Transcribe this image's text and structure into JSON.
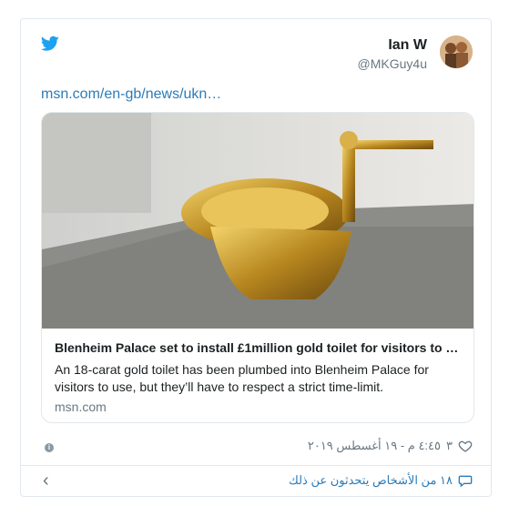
{
  "author": {
    "name": "Ian W",
    "handle": "@MKGuy4u"
  },
  "link_text": "msn.com/en-gb/news/ukn…",
  "card": {
    "title": "Blenheim Palace set to install £1million gold toilet for visitors to …",
    "description": "An 18-carat gold toilet has been plumbed into Blenheim Palace for visitors to use, but they’ll have to respect a strict time-limit.",
    "domain": "msn.com"
  },
  "meta": {
    "likes": "٣",
    "timestamp": "٤:٤٥ م - ١٩ أغسطس ٢٠١٩"
  },
  "conversation": "١٨ من الأشخاص يتحدثون عن ذلك",
  "icons": {
    "bird": "twitter-bird-icon",
    "info": "info-icon",
    "heart": "heart-icon",
    "bubble": "speech-bubble-icon",
    "back": "chevron-left-icon"
  },
  "colors": {
    "accent": "#1da1f2",
    "link": "#2b7bb9",
    "muted": "#697882"
  }
}
